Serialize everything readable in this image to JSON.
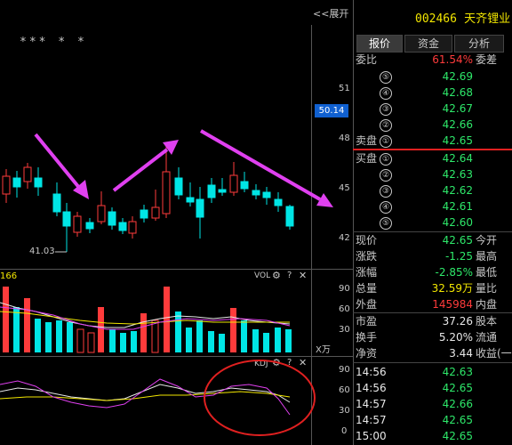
{
  "header": {
    "expand_label": "<<展开",
    "stock_code": "002466",
    "stock_name": "天齐锂业"
  },
  "tabs": [
    {
      "label": "报价",
      "active": true
    },
    {
      "label": "资金",
      "active": false
    },
    {
      "label": "分析",
      "active": false
    }
  ],
  "main_chart": {
    "stars": "*** * *",
    "price_axis": [
      "51",
      "48",
      "45",
      "42"
    ],
    "current_price_tag": "50.14",
    "low_label": "41.03"
  },
  "vol_panel": {
    "title": "VOL",
    "left_value": "166",
    "axis": [
      "90",
      "60",
      "30"
    ],
    "unit": "X万"
  },
  "kdj_panel": {
    "title": "KDJ",
    "axis": [
      "90",
      "60",
      "30",
      "0"
    ]
  },
  "quote": {
    "weibi": {
      "label": "委比",
      "value": "61.54%",
      "label2": "委差"
    },
    "sell": [
      {
        "label": "",
        "num": "⑤",
        "price": "42.69"
      },
      {
        "label": "",
        "num": "④",
        "price": "42.68"
      },
      {
        "label": "",
        "num": "③",
        "price": "42.67"
      },
      {
        "label": "",
        "num": "②",
        "price": "42.66"
      },
      {
        "label": "卖盘",
        "num": "①",
        "price": "42.65"
      }
    ],
    "buy": [
      {
        "label": "买盘",
        "num": "①",
        "price": "42.64"
      },
      {
        "label": "",
        "num": "②",
        "price": "42.63"
      },
      {
        "label": "",
        "num": "③",
        "price": "42.62"
      },
      {
        "label": "",
        "num": "④",
        "price": "42.61"
      },
      {
        "label": "",
        "num": "⑤",
        "price": "42.60"
      }
    ],
    "stats": [
      {
        "label": "现价",
        "value": "42.65",
        "color": "green",
        "label2": "今开"
      },
      {
        "label": "涨跌",
        "value": "-1.25",
        "color": "green",
        "label2": "最高"
      },
      {
        "label": "涨幅",
        "value": "-2.85%",
        "color": "green",
        "label2": "最低"
      },
      {
        "label": "总量",
        "value": "32.59万",
        "color": "yellow",
        "label2": "量比"
      },
      {
        "label": "外盘",
        "value": "145984",
        "color": "red",
        "label2": "内盘"
      }
    ],
    "stats2": [
      {
        "label": "市盈",
        "value": "37.26",
        "color": "white",
        "label2": "股本"
      },
      {
        "label": "换手",
        "value": "5.20%",
        "color": "white",
        "label2": "流通"
      },
      {
        "label": "净资",
        "value": "3.44",
        "color": "white",
        "label2": "收益(一"
      }
    ],
    "ticks": [
      {
        "time": "14:56",
        "price": "42.63"
      },
      {
        "time": "14:56",
        "price": "42.65"
      },
      {
        "time": "14:57",
        "price": "42.66"
      },
      {
        "time": "14:57",
        "price": "42.65"
      },
      {
        "time": "15:00",
        "price": "42.65"
      }
    ]
  },
  "colors": {
    "magenta": "#e040f0",
    "candle_red": "#ff3b3b",
    "candle_cyan": "#00e5e5",
    "ma_white": "#e8e8e8",
    "ma_yellow": "#f2e600",
    "circle": "#e02020"
  }
}
